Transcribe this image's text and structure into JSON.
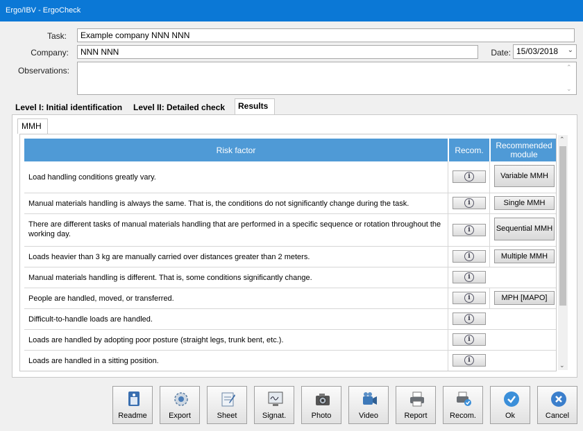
{
  "window": {
    "title": "Ergo/IBV - ErgoCheck"
  },
  "form": {
    "task_label": "Task:",
    "task_value": "Example company NNN NNN",
    "company_label": "Company:",
    "company_value": "NNN NNN",
    "date_label": "Date:",
    "date_value": "15/03/2018",
    "observations_label": "Observations:",
    "observations_value": ""
  },
  "tabs": [
    {
      "label": "Level I: Initial identification",
      "active": false
    },
    {
      "label": "Level II: Detailed check",
      "active": false
    },
    {
      "label": "Results",
      "active": true
    }
  ],
  "subtab": "MMH",
  "table": {
    "headers": {
      "risk": "Risk factor",
      "recom": "Recom.",
      "module": "Recommended module"
    },
    "rows": [
      {
        "text": "Load handling conditions greatly vary.",
        "module": "Variable MMH"
      },
      {
        "text": "Manual materials handling is always the same. That is, the conditions do not significantly change during the task.",
        "module": "Single MMH"
      },
      {
        "text": "There are different tasks of manual materials handling that are performed in a specific sequence or rotation throughout the working day.",
        "module": "Sequential MMH"
      },
      {
        "text": "Loads heavier than 3 kg are manually carried over distances greater than 2 meters.",
        "module": "Multiple MMH"
      },
      {
        "text": "Manual materials handling is different. That is, some conditions significantly change.",
        "module": ""
      },
      {
        "text": "People are handled, moved, or transferred.",
        "module": "MPH [MAPO]"
      },
      {
        "text": "Difficult-to-handle loads are handled.",
        "module": ""
      },
      {
        "text": "Loads are handled by adopting poor posture (straight legs, trunk bent, etc.).",
        "module": ""
      },
      {
        "text": "Loads are handled in a sitting position.",
        "module": ""
      }
    ]
  },
  "toolbar": [
    {
      "label": "Readme",
      "icon": "readme-icon"
    },
    {
      "label": "Export",
      "icon": "export-icon"
    },
    {
      "label": "Sheet",
      "icon": "sheet-icon"
    },
    {
      "label": "Signat.",
      "icon": "signature-icon"
    },
    {
      "label": "Photo",
      "icon": "camera-icon"
    },
    {
      "label": "Video",
      "icon": "video-icon"
    },
    {
      "label": "Report",
      "icon": "printer-icon"
    },
    {
      "label": "Recom.",
      "icon": "recommendation-icon"
    },
    {
      "label": "Ok",
      "icon": "check-icon"
    },
    {
      "label": "Cancel",
      "icon": "cancel-icon"
    }
  ],
  "colors": {
    "titlebar": "#0b78d6",
    "header": "#4f9ad6",
    "ok": "#3b8fd9",
    "cancel": "#3b7fcc"
  }
}
